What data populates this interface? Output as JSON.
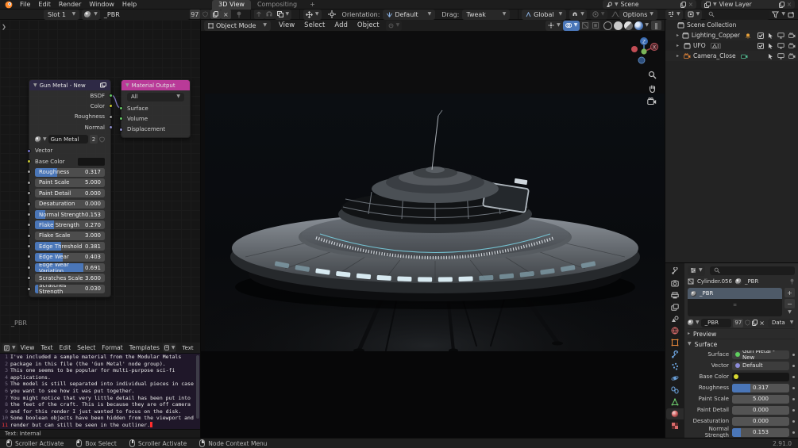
{
  "topbar": {
    "menus": [
      "File",
      "Edit",
      "Render",
      "Window",
      "Help"
    ],
    "tabs": [
      {
        "label": "3D View",
        "active": true
      },
      {
        "label": "Compositing",
        "active": false
      }
    ],
    "new_tab_label": "+",
    "scene_selector": {
      "label": "Scene"
    },
    "view_layer_selector": {
      "label": "View Layer"
    }
  },
  "tool_settings": {
    "slot": "Slot 1",
    "material_name": "_PBR",
    "material_users": "97",
    "orientation_label": "Orientation:",
    "orientation_value": "Default",
    "drag_label": "Drag:",
    "drag_value": "Tweak",
    "transform_space": "Global",
    "options_label": "Options"
  },
  "viewport": {
    "mode": "Object Mode",
    "menus": [
      "View",
      "Select",
      "Add",
      "Object"
    ],
    "gizmo_axis_z": "Z",
    "gizmo_axis_x": "X"
  },
  "node_editor": {
    "tree_name": "_PBR",
    "group_node": {
      "title": "Gun Metal - New",
      "header_color": "#2e2945",
      "outputs": [
        {
          "name": "BSDF",
          "color": "#63c763"
        },
        {
          "name": "Color",
          "color": "#c8c832"
        },
        {
          "name": "Roughness",
          "color": "#a1a1a1"
        },
        {
          "name": "Normal",
          "color": "#8c8cc9"
        }
      ],
      "material": {
        "name": "Gun Metal",
        "users": "2"
      },
      "inputs": [
        {
          "label": "Vector",
          "widget": "label",
          "socket": "#7070c8"
        },
        {
          "label": "Base Color",
          "widget": "color",
          "socket": "#c8c832"
        },
        {
          "label": "Roughness",
          "widget": "slider",
          "value": "0.317",
          "fill": 0.32,
          "socket": "#a1a1a1"
        },
        {
          "label": "Paint Scale",
          "widget": "num",
          "value": "5.000",
          "socket": "#a1a1a1"
        },
        {
          "label": "Paint Detail",
          "widget": "num",
          "value": "0.000",
          "socket": "#a1a1a1"
        },
        {
          "label": "Desaturation",
          "widget": "num",
          "value": "0.000",
          "socket": "#a1a1a1"
        },
        {
          "label": "Normal Strength",
          "widget": "slider",
          "value": "0.153",
          "fill": 0.15,
          "socket": "#a1a1a1"
        },
        {
          "label": "Flake Strength",
          "widget": "slider",
          "value": "0.270",
          "fill": 0.27,
          "socket": "#a1a1a1"
        },
        {
          "label": "Flake Scale",
          "widget": "num",
          "value": "3.000",
          "socket": "#a1a1a1"
        },
        {
          "label": "Edge Threshold",
          "widget": "slider",
          "value": "0.381",
          "fill": 0.38,
          "socket": "#a1a1a1"
        },
        {
          "label": "Edge Wear",
          "widget": "slider",
          "value": "0.403",
          "fill": 0.4,
          "socket": "#a1a1a1"
        },
        {
          "label": "Edge Wear Variation",
          "widget": "slider",
          "value": "0.691",
          "fill": 0.69,
          "socket": "#a1a1a1"
        },
        {
          "label": "Scratches Scale",
          "widget": "num",
          "value": "3.600",
          "socket": "#a1a1a1"
        },
        {
          "label": "Scratches Strength",
          "widget": "slider",
          "value": "0.030",
          "fill": 0.04,
          "socket": "#a1a1a1"
        }
      ]
    },
    "output_node": {
      "title": "Material Output",
      "header_color": "#b93a98",
      "target": "All",
      "inputs": [
        {
          "name": "Surface",
          "color": "#63c763"
        },
        {
          "name": "Volume",
          "color": "#63c763"
        },
        {
          "name": "Displacement",
          "color": "#8c8cc9"
        }
      ]
    }
  },
  "outliner": {
    "rows": [
      {
        "label": "Scene Collection",
        "icon": "collection",
        "indent": 0,
        "disclosure": false,
        "extras": [],
        "toggles": []
      },
      {
        "label": "Lighting_Copper",
        "icon": "collection",
        "indent": 1,
        "disclosure": true,
        "extras": [
          "light"
        ],
        "toggles": [
          "check",
          "cursor",
          "monitor",
          "camera"
        ]
      },
      {
        "label": "UFO",
        "icon": "collection",
        "indent": 1,
        "disclosure": true,
        "extras": [
          "meshbadge"
        ],
        "toggles": [
          "check",
          "cursor",
          "monitor",
          "camera"
        ]
      },
      {
        "label": "Camera_Close",
        "icon": "camera-obj",
        "indent": 1,
        "disclosure": true,
        "extras": [
          "camera-data"
        ],
        "toggles": [
          "cursor",
          "monitor",
          "camera"
        ]
      }
    ]
  },
  "properties": {
    "tabs": [
      {
        "name": "tool",
        "color": "#b8b8b8",
        "active": false
      },
      {
        "name": "render",
        "color": "#b8b8b8",
        "active": false
      },
      {
        "name": "output",
        "color": "#b8b8b8",
        "active": false
      },
      {
        "name": "view-layer",
        "color": "#b8b8b8",
        "active": false
      },
      {
        "name": "scene",
        "color": "#b8b8b8",
        "active": false
      },
      {
        "name": "world",
        "color": "#d96a6a",
        "active": false
      },
      {
        "name": "object",
        "color": "#e8883a",
        "active": false
      },
      {
        "name": "modifiers",
        "color": "#6a9fd8",
        "active": false
      },
      {
        "name": "particles",
        "color": "#6a9fd8",
        "active": false
      },
      {
        "name": "physics",
        "color": "#6a9fd8",
        "active": false
      },
      {
        "name": "constraints",
        "color": "#6a9fd8",
        "active": false
      },
      {
        "name": "data",
        "color": "#6ac76a",
        "active": false
      },
      {
        "name": "material",
        "color": "#d96a6a",
        "active": true
      },
      {
        "name": "texture",
        "color": "#d96a6a",
        "active": false
      }
    ],
    "breadcrumb": {
      "object": "Cylinder.056",
      "material": "_PBR"
    },
    "slot_list": {
      "selected": "_PBR"
    },
    "datablock": {
      "name": "_PBR",
      "users": "97",
      "link_mode": "Data"
    },
    "panels": {
      "preview": "Preview",
      "surface": "Surface"
    },
    "surface_rows": [
      {
        "label": "Surface",
        "widget": "chip",
        "dot": "#5fcf5f",
        "value": "Gun Metal - New"
      },
      {
        "label": "Vector",
        "widget": "chip",
        "dot": "#8c8cd9",
        "value": "Default"
      },
      {
        "label": "Base Color",
        "widget": "color",
        "dot": "#d8d832",
        "value": ""
      },
      {
        "label": "Roughness",
        "widget": "slider",
        "value": "0.317",
        "fill": 0.32
      },
      {
        "label": "Paint Scale",
        "widget": "num",
        "value": "5.000"
      },
      {
        "label": "Paint Detail",
        "widget": "num",
        "value": "0.000"
      },
      {
        "label": "Desaturation",
        "widget": "num",
        "value": "0.000"
      },
      {
        "label": "Normal Strength",
        "widget": "slider",
        "value": "0.153",
        "fill": 0.15
      }
    ]
  },
  "text_editor": {
    "menus": [
      "View",
      "Text",
      "Edit",
      "Select",
      "Format",
      "Templates"
    ],
    "datablock": "Text",
    "lines": [
      "I've included a sample material from the Modular Metals",
      "package in this file (the 'Gun Metal' node group).",
      "This one seems to be popular for multi-purpose sci-fi",
      "applications.",
      "The model is still separated into individual pieces in case",
      "you want to see how it was put together.",
      "You might notice that very little detail has been put into",
      "the feet of the craft. This is because they are off camera",
      "and for this render I just wanted to focus on the disk.",
      "Some boolean objects have been hidden from the viewport and",
      "render but can still be seen in the outliner."
    ],
    "cursor_line": 11,
    "footer": "Text: Internal"
  },
  "status_bar": {
    "hints": [
      {
        "icon": "mouse-lmb",
        "label": "Scroller Activate"
      },
      {
        "icon": "mouse-lmb",
        "label": "Box Select"
      },
      {
        "icon": "mouse-mmb",
        "label": "Scroller Activate"
      },
      {
        "icon": "mouse-rmb",
        "label": "Node Context Menu"
      }
    ],
    "version": "2.91.0"
  },
  "colors": {
    "accent_blue": "#4a76b8",
    "header_bg": "#1d1d1d",
    "rim_light": "#dff2fa"
  }
}
